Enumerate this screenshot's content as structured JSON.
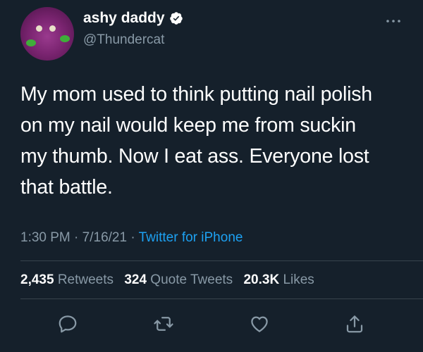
{
  "user": {
    "display_name": "ashy daddy",
    "handle": "@Thundercat",
    "verified": true,
    "avatar_icon": "purple-dinosaur-avatar"
  },
  "tweet": {
    "text": "My mom used to think putting nail polish\non my nail would keep me from suckin\nmy thumb. Now I eat ass. Everyone lost\nthat battle.",
    "time": "1:30 PM",
    "date": "7/16/21",
    "separator": "·",
    "source": "Twitter for iPhone"
  },
  "stats": {
    "retweets_count": "2,435",
    "retweets_label": "Retweets",
    "quote_count": "324",
    "quote_label": "Quote Tweets",
    "likes_count": "20.3K",
    "likes_label": "Likes"
  },
  "actions": [
    {
      "name": "reply",
      "icon": "reply-icon"
    },
    {
      "name": "retweet",
      "icon": "retweet-icon"
    },
    {
      "name": "like",
      "icon": "heart-icon"
    },
    {
      "name": "share",
      "icon": "share-icon"
    }
  ],
  "colors": {
    "background": "#15202b",
    "secondary_text": "#8899a6",
    "link": "#1da1f2",
    "divider": "#38444d"
  }
}
